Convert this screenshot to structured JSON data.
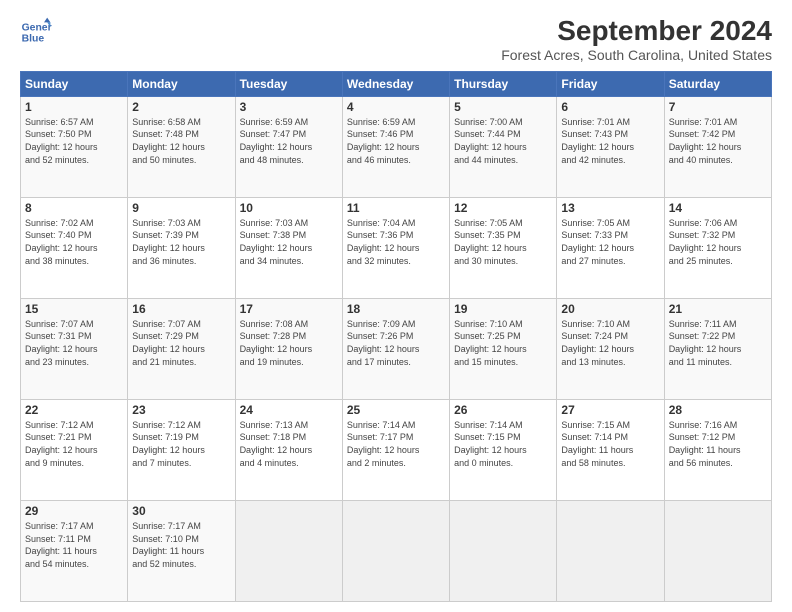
{
  "logo": {
    "line1": "General",
    "line2": "Blue"
  },
  "title": "September 2024",
  "subtitle": "Forest Acres, South Carolina, United States",
  "days_of_week": [
    "Sunday",
    "Monday",
    "Tuesday",
    "Wednesday",
    "Thursday",
    "Friday",
    "Saturday"
  ],
  "weeks": [
    [
      {
        "day": "1",
        "info": "Sunrise: 6:57 AM\nSunset: 7:50 PM\nDaylight: 12 hours\nand 52 minutes."
      },
      {
        "day": "2",
        "info": "Sunrise: 6:58 AM\nSunset: 7:48 PM\nDaylight: 12 hours\nand 50 minutes."
      },
      {
        "day": "3",
        "info": "Sunrise: 6:59 AM\nSunset: 7:47 PM\nDaylight: 12 hours\nand 48 minutes."
      },
      {
        "day": "4",
        "info": "Sunrise: 6:59 AM\nSunset: 7:46 PM\nDaylight: 12 hours\nand 46 minutes."
      },
      {
        "day": "5",
        "info": "Sunrise: 7:00 AM\nSunset: 7:44 PM\nDaylight: 12 hours\nand 44 minutes."
      },
      {
        "day": "6",
        "info": "Sunrise: 7:01 AM\nSunset: 7:43 PM\nDaylight: 12 hours\nand 42 minutes."
      },
      {
        "day": "7",
        "info": "Sunrise: 7:01 AM\nSunset: 7:42 PM\nDaylight: 12 hours\nand 40 minutes."
      }
    ],
    [
      {
        "day": "8",
        "info": "Sunrise: 7:02 AM\nSunset: 7:40 PM\nDaylight: 12 hours\nand 38 minutes."
      },
      {
        "day": "9",
        "info": "Sunrise: 7:03 AM\nSunset: 7:39 PM\nDaylight: 12 hours\nand 36 minutes."
      },
      {
        "day": "10",
        "info": "Sunrise: 7:03 AM\nSunset: 7:38 PM\nDaylight: 12 hours\nand 34 minutes."
      },
      {
        "day": "11",
        "info": "Sunrise: 7:04 AM\nSunset: 7:36 PM\nDaylight: 12 hours\nand 32 minutes."
      },
      {
        "day": "12",
        "info": "Sunrise: 7:05 AM\nSunset: 7:35 PM\nDaylight: 12 hours\nand 30 minutes."
      },
      {
        "day": "13",
        "info": "Sunrise: 7:05 AM\nSunset: 7:33 PM\nDaylight: 12 hours\nand 27 minutes."
      },
      {
        "day": "14",
        "info": "Sunrise: 7:06 AM\nSunset: 7:32 PM\nDaylight: 12 hours\nand 25 minutes."
      }
    ],
    [
      {
        "day": "15",
        "info": "Sunrise: 7:07 AM\nSunset: 7:31 PM\nDaylight: 12 hours\nand 23 minutes."
      },
      {
        "day": "16",
        "info": "Sunrise: 7:07 AM\nSunset: 7:29 PM\nDaylight: 12 hours\nand 21 minutes."
      },
      {
        "day": "17",
        "info": "Sunrise: 7:08 AM\nSunset: 7:28 PM\nDaylight: 12 hours\nand 19 minutes."
      },
      {
        "day": "18",
        "info": "Sunrise: 7:09 AM\nSunset: 7:26 PM\nDaylight: 12 hours\nand 17 minutes."
      },
      {
        "day": "19",
        "info": "Sunrise: 7:10 AM\nSunset: 7:25 PM\nDaylight: 12 hours\nand 15 minutes."
      },
      {
        "day": "20",
        "info": "Sunrise: 7:10 AM\nSunset: 7:24 PM\nDaylight: 12 hours\nand 13 minutes."
      },
      {
        "day": "21",
        "info": "Sunrise: 7:11 AM\nSunset: 7:22 PM\nDaylight: 12 hours\nand 11 minutes."
      }
    ],
    [
      {
        "day": "22",
        "info": "Sunrise: 7:12 AM\nSunset: 7:21 PM\nDaylight: 12 hours\nand 9 minutes."
      },
      {
        "day": "23",
        "info": "Sunrise: 7:12 AM\nSunset: 7:19 PM\nDaylight: 12 hours\nand 7 minutes."
      },
      {
        "day": "24",
        "info": "Sunrise: 7:13 AM\nSunset: 7:18 PM\nDaylight: 12 hours\nand 4 minutes."
      },
      {
        "day": "25",
        "info": "Sunrise: 7:14 AM\nSunset: 7:17 PM\nDaylight: 12 hours\nand 2 minutes."
      },
      {
        "day": "26",
        "info": "Sunrise: 7:14 AM\nSunset: 7:15 PM\nDaylight: 12 hours\nand 0 minutes."
      },
      {
        "day": "27",
        "info": "Sunrise: 7:15 AM\nSunset: 7:14 PM\nDaylight: 11 hours\nand 58 minutes."
      },
      {
        "day": "28",
        "info": "Sunrise: 7:16 AM\nSunset: 7:12 PM\nDaylight: 11 hours\nand 56 minutes."
      }
    ],
    [
      {
        "day": "29",
        "info": "Sunrise: 7:17 AM\nSunset: 7:11 PM\nDaylight: 11 hours\nand 54 minutes."
      },
      {
        "day": "30",
        "info": "Sunrise: 7:17 AM\nSunset: 7:10 PM\nDaylight: 11 hours\nand 52 minutes."
      },
      {
        "day": "",
        "info": ""
      },
      {
        "day": "",
        "info": ""
      },
      {
        "day": "",
        "info": ""
      },
      {
        "day": "",
        "info": ""
      },
      {
        "day": "",
        "info": ""
      }
    ]
  ]
}
